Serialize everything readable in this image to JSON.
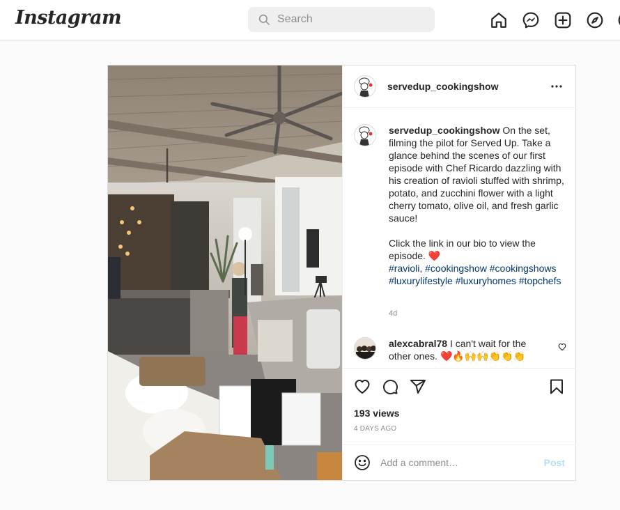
{
  "app": {
    "logo": "Instagram"
  },
  "search": {
    "placeholder": "Search"
  },
  "nav": {
    "icons": [
      "home-icon",
      "messenger-icon",
      "new-post-icon",
      "explore-icon",
      "activity-icon"
    ]
  },
  "post": {
    "username": "servedup_cookingshow",
    "caption": {
      "username": "servedup_cookingshow",
      "text": " On the set, filming the pilot for Served Up. Take a glance behind the scenes of our first episode with Chef Ricardo dazzling with his creation of ravioli stuffed with shrimp, potato, and zucchini flower with a light cherry tomato, olive oil, and fresh garlic sauce!",
      "text2": "Click the link in our bio to view the episode. ❤️",
      "hashtags": [
        {
          "tag": "#ravioli",
          "suffix": ", "
        },
        {
          "tag": "#cookingshow",
          "suffix": " "
        },
        {
          "tag": "#cookingshows",
          "suffix": " "
        },
        {
          "tag": "#luxurylifestyle",
          "suffix": " "
        },
        {
          "tag": "#luxuryhomes",
          "suffix": " "
        },
        {
          "tag": "#topchefs",
          "suffix": ""
        }
      ],
      "time": "4d"
    },
    "comment": {
      "username": "alexcabral78",
      "text": " I can't wait for the other ones. ❤️🔥🙌🙌👏👏👏"
    },
    "views": "193 views",
    "time_ago": "4 DAYS AGO",
    "add_comment": {
      "placeholder": "Add a comment…",
      "post_label": "Post"
    }
  },
  "colors": {
    "accent": "#0095f6",
    "post_disabled": "#b2dffc",
    "hashtag": "#00376b",
    "heart": "#ed4956"
  }
}
